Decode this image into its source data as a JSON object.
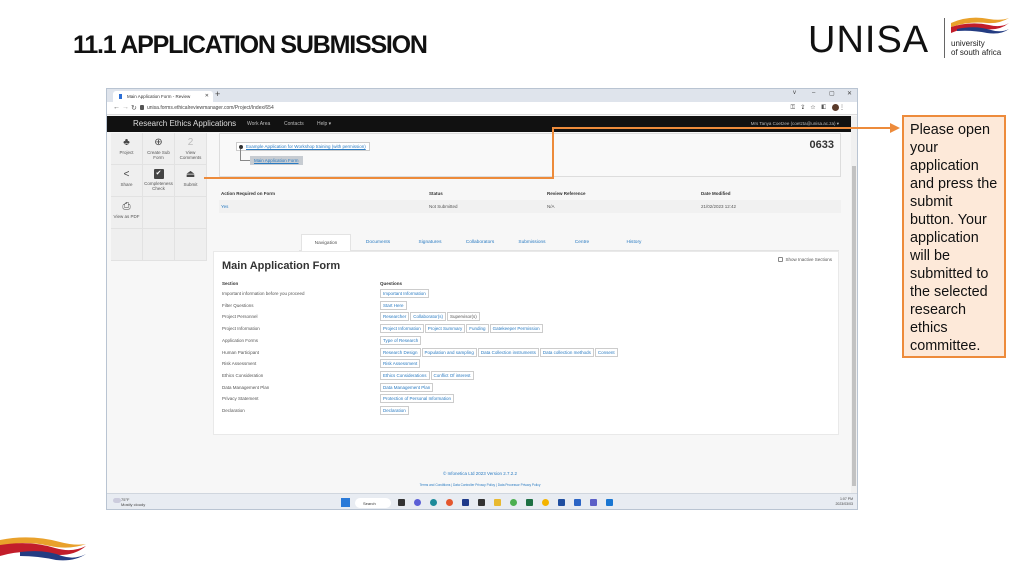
{
  "slide": {
    "title": "11.1  APPLICATION SUBMISSION",
    "logo": {
      "word": "UNISA",
      "sub_line1": "university",
      "sub_line2": "of south africa"
    },
    "callout": "Please open your application and press the submit button. Your application will be submitted to the selected research ethics committee.",
    "accent_color": "#ed8b3b"
  },
  "browser": {
    "tab_title": "Main Application Form - Review",
    "url": "unisa.forms.ethicalreviewmanager.com/Project/Index/654",
    "window_controls": [
      "v",
      "–",
      "▢",
      "✕"
    ]
  },
  "app": {
    "brand": "Research Ethics Applications",
    "nav": [
      "Work Area",
      "Contacts",
      "Help ▾"
    ],
    "user": "Mrs Tanya Coetzee (coetzta@unisa.ac.za) ▾"
  },
  "toolbar": [
    {
      "label": "Project",
      "icon": "project-tree-icon"
    },
    {
      "label": "Create Sub Form",
      "icon": "plus-circle-icon"
    },
    {
      "label": "View Comments",
      "icon": "comments-count-icon",
      "count": "2"
    },
    {
      "label": "Share",
      "icon": "share-icon"
    },
    {
      "label": "Completeness Check",
      "icon": "checkbox-icon"
    },
    {
      "label": "Submit",
      "icon": "upload-icon"
    },
    {
      "label": "View as PDF",
      "icon": "printer-icon"
    }
  ],
  "project": {
    "link": "Example Application for Workshop training (with permission)",
    "form": "Main Application Form",
    "number": "0633"
  },
  "status_table": {
    "headers": [
      "Action Required on Form",
      "Status",
      "Review Reference",
      "Date Modified"
    ],
    "row": [
      "Yes",
      "Not Submitted",
      "N/A",
      "21/02/2023 12:42"
    ]
  },
  "tabs": [
    "Navigation",
    "Documents",
    "Signatures",
    "Collaborators",
    "Submissions",
    "Centre",
    "History"
  ],
  "active_tab": "Navigation",
  "main_form": {
    "title": "Main Application Form",
    "show_inactive_label": "Show Inactive Sections",
    "col_section": "Section",
    "col_questions": "Questions",
    "rows": [
      {
        "section": "Important information before you proceed",
        "questions": [
          "Important Information"
        ]
      },
      {
        "section": "Filter Questions",
        "questions": [
          "Start Here"
        ]
      },
      {
        "section": "Project Personnel",
        "questions": [
          "Researcher",
          "Collaborator(s)",
          "Supervisor(s)"
        ]
      },
      {
        "section": "Project Information",
        "questions": [
          "Project Information",
          "Project Summary",
          "Funding",
          "Gatekeeper Permission"
        ]
      },
      {
        "section": "Application Forms",
        "questions": [
          "Type of Research"
        ]
      },
      {
        "section": "Human Participant",
        "questions": [
          "Research Design",
          "Population and sampling",
          "Data Collection instruments",
          "Data collection methods",
          "Consent"
        ]
      },
      {
        "section": "Risk Assessment",
        "questions": [
          "Risk Assessment"
        ]
      },
      {
        "section": "Ethics Consideration",
        "questions": [
          "Ethics Considerations",
          "Conflict Of interest"
        ]
      },
      {
        "section": "Data Management Plan",
        "questions": [
          "Data Management Plan"
        ]
      },
      {
        "section": "Privacy Statement",
        "questions": [
          "Protection of Personal Information"
        ]
      },
      {
        "section": "Declaration",
        "questions": [
          "Declaration"
        ]
      }
    ]
  },
  "footer": {
    "copyright": "© Infonetica Ltd 2023 Version 2.7.2.2",
    "links": "Terms and Conditions | Data Controller Privacy Policy | Data Processor Privacy Policy"
  },
  "taskbar": {
    "temp": "75°F",
    "weather": "Mostly cloudy",
    "search": "Search",
    "time": "1:07 PM",
    "date": "2023/03/03"
  }
}
